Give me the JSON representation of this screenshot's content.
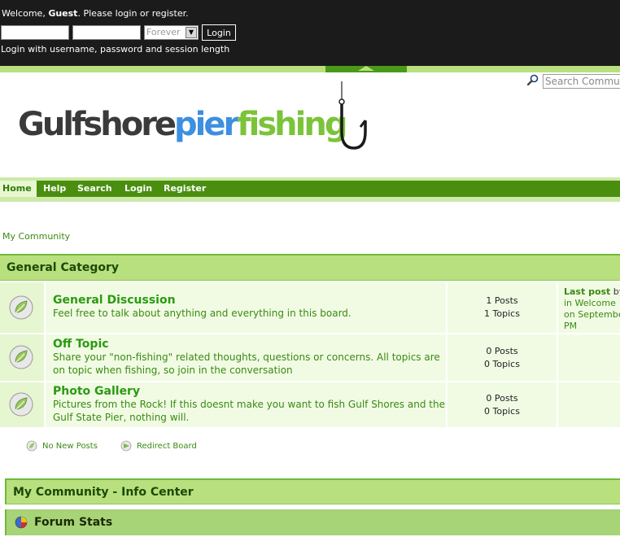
{
  "topbar": {
    "welcome_prefix": "Welcome, ",
    "guest": "Guest",
    "welcome_mid": ". Please ",
    "login_link": "login",
    "or": " or ",
    "register_link": "register",
    "period": ".",
    "session_value": "Forever",
    "login_button": "Login",
    "hint": "Login with username, password and session length"
  },
  "search": {
    "placeholder": "Search Community"
  },
  "logo": {
    "part1": "Gulfshore",
    "part2": "pier",
    "part3": "fishing"
  },
  "nav": {
    "items": [
      "Home",
      "Help",
      "Search",
      "Login",
      "Register"
    ]
  },
  "breadcrumb": "My Community",
  "category": {
    "title": "General Category",
    "boards": [
      {
        "title": "General Discussion",
        "desc": "Feel free to talk about anything and everything in this board.",
        "posts": "1 Posts",
        "topics": "1 Topics",
        "last_label": "Last post",
        "last_by": " by",
        "last_in": "in Welcome",
        "last_on": "on September",
        "last_pm": "PM"
      },
      {
        "title": "Off Topic",
        "desc": "Share your \"non-fishing\" related thoughts, questions or concerns. All topics are on topic when fishing, so join in the conversation",
        "posts": "0 Posts",
        "topics": "0 Topics"
      },
      {
        "title": "Photo Gallery",
        "desc": "Pictures from the Rock! If this doesnt make you want to fish Gulf Shores and the Gulf State Pier, nothing will.",
        "posts": "0 Posts",
        "topics": "0 Topics"
      }
    ]
  },
  "legend": {
    "no_new": "No New Posts",
    "redirect": "Redirect Board"
  },
  "info_center": {
    "title": "My Community - Info Center",
    "forum_stats": "Forum Stats"
  },
  "colors": {
    "accent_green": "#4a8e10",
    "header_green": "#b9e07e",
    "topbar": "#1b1b1b"
  }
}
